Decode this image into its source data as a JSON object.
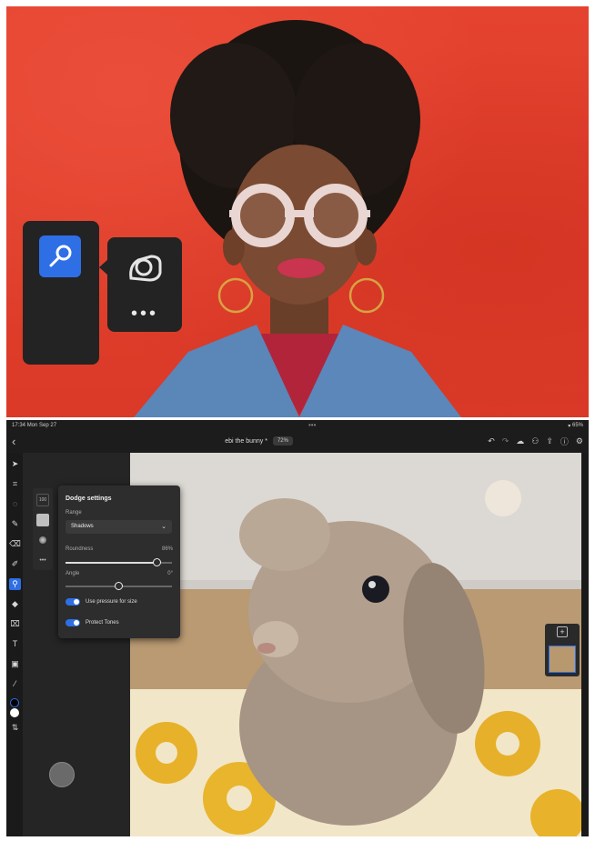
{
  "hero": {
    "tool_icon": "dodge-brush-icon",
    "gesture_icon": "ok-hand-gesture-icon",
    "more_label": "•••"
  },
  "status_bar": {
    "time": "17:34",
    "date": "Mon Sep 27",
    "more_dots": "•••",
    "battery": "65%"
  },
  "title_bar": {
    "back": "‹",
    "document_title": "ebi the bunny *",
    "zoom": "72%"
  },
  "left_toolbar": {
    "tools": [
      "select-icon",
      "transform-icon",
      "lasso-icon",
      "brush-icon",
      "eraser-icon",
      "clone-stamp-icon",
      "dodge-icon",
      "fill-icon",
      "crop-icon",
      "type-icon",
      "place-image-icon",
      "eyedropper-icon"
    ]
  },
  "subtools": {
    "size_label": "100",
    "more": "•••"
  },
  "dodge_panel": {
    "title": "Dodge settings",
    "range_label": "Range",
    "range_value": "Shadows",
    "roundness_label": "Roundness",
    "roundness_value": "86%",
    "roundness_fraction": 0.86,
    "angle_label": "Angle",
    "angle_value": "0°",
    "angle_fraction": 0.5,
    "toggles": [
      {
        "label": "Use pressure for size",
        "on": true
      },
      {
        "label": "Protect Tones",
        "on": true
      }
    ]
  },
  "colors": {
    "accent": "#2e6fe6",
    "hero_red": "#e2412e",
    "panel_dark": "#2d2d2d"
  }
}
